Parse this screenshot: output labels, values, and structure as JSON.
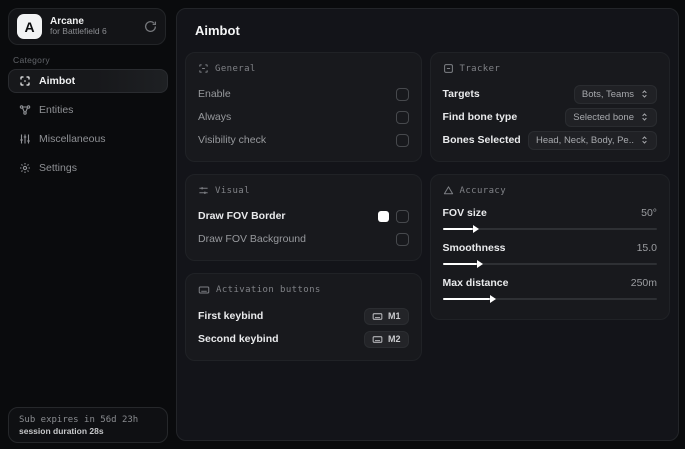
{
  "sidebar": {
    "app": {
      "initial": "A",
      "name": "Arcane",
      "subtitle": "for Battlefield 6"
    },
    "category_label": "Category",
    "items": [
      {
        "label": "Aimbot",
        "icon": "crosshair-scan-icon",
        "active": true
      },
      {
        "label": "Entities",
        "icon": "network-icon",
        "active": false
      },
      {
        "label": "Miscellaneous",
        "icon": "sliders-vertical-icon",
        "active": false
      },
      {
        "label": "Settings",
        "icon": "gear-icon",
        "active": false
      }
    ],
    "footer": {
      "line1": "Sub expires in 56d 23h",
      "line2": "session duration 28s"
    }
  },
  "main": {
    "title": "Aimbot",
    "general": {
      "title": "General",
      "icon": "scan-frame-icon",
      "rows": [
        {
          "label": "Enable",
          "checked": false
        },
        {
          "label": "Always",
          "checked": false
        },
        {
          "label": "Visibility check",
          "checked": false
        }
      ]
    },
    "visual": {
      "title": "Visual",
      "icon": "sliders-icon",
      "rows": [
        {
          "label": "Draw FOV Border",
          "swatch_color": "#ffffff",
          "checked": false
        },
        {
          "label": "Draw FOV Background",
          "checked": false
        }
      ]
    },
    "activation": {
      "title": "Activation buttons",
      "icon": "keyboard-icon",
      "rows": [
        {
          "label": "First keybind",
          "key": "M1"
        },
        {
          "label": "Second keybind",
          "key": "M2"
        }
      ]
    },
    "tracker": {
      "title": "Tracker",
      "icon": "box-minus-icon",
      "rows": [
        {
          "label": "Targets",
          "value": "Bots, Teams"
        },
        {
          "label": "Find bone type",
          "value": "Selected bone"
        },
        {
          "label": "Bones Selected",
          "value": "Head, Neck, Body, Pe.."
        }
      ]
    },
    "accuracy": {
      "title": "Accuracy",
      "icon": "triangle-icon",
      "rows": [
        {
          "label": "FOV size",
          "value": "50°",
          "fill": "14%"
        },
        {
          "label": "Smoothness",
          "value": "15.0",
          "fill": "16%"
        },
        {
          "label": "Max distance",
          "value": "250m",
          "fill": "22%"
        }
      ]
    }
  },
  "colors": {
    "swatch": "#ffffff",
    "accent": "#ffffff",
    "panel": "#131419",
    "card": "#18191d"
  }
}
